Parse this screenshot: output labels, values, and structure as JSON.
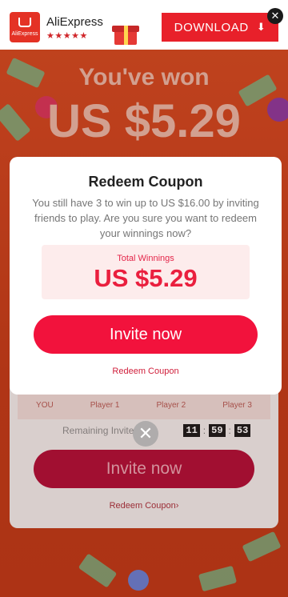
{
  "banner": {
    "logo_text": "AliExpress",
    "app_name": "AliExpress",
    "rating_stars": "★★★★★",
    "download_label": "DOWNLOAD",
    "download_icon": "download-arrow-icon",
    "close_glyph": "✕"
  },
  "background": {
    "won_title": "You've won",
    "won_amount": "US $5.29",
    "players": [
      "YOU",
      "Player 1",
      "Player 2",
      "Player 3"
    ],
    "remaining_label": "Remaining Invite",
    "timer": {
      "hours": "11",
      "minutes": "59",
      "seconds": "53"
    },
    "invite_label": "Invite now",
    "redeem_label": "Redeem Coupon"
  },
  "modal": {
    "title": "Redeem Coupon",
    "description": "You still have 3 to win up to US $16.00 by inviting friends to play. Are you sure you want to redeem your winnings now?",
    "winnings_label": "Total Winnings",
    "winnings_amount": "US $5.29",
    "invite_label": "Invite now",
    "redeem_label": "Redeem Coupon",
    "close_glyph": "✕"
  },
  "colors": {
    "accent": "#f2123c",
    "brand_red": "#e8202a",
    "background": "#c8431c"
  }
}
